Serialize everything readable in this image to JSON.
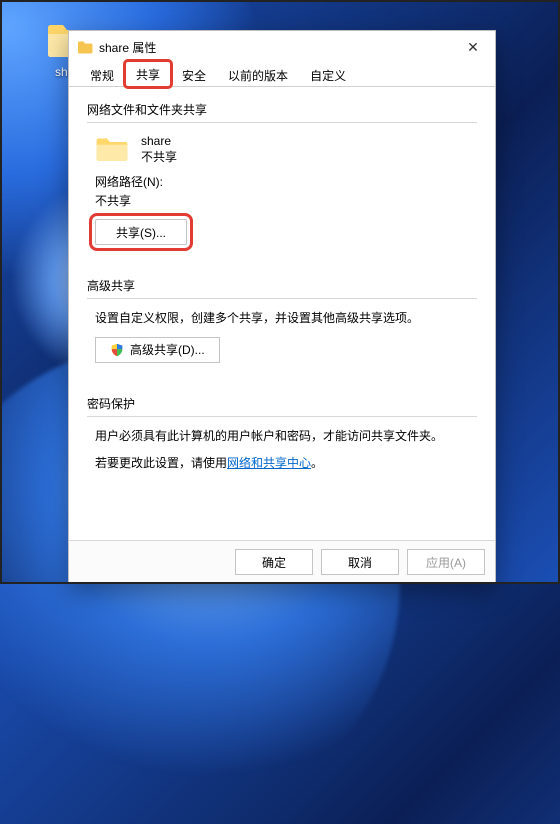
{
  "desktop": {
    "folder_label": "share"
  },
  "dialog": {
    "title": "share 属性",
    "tabs": {
      "general": "常规",
      "sharing": "共享",
      "security": "安全",
      "previous": "以前的版本",
      "customize": "自定义"
    },
    "section_network": {
      "title": "网络文件和文件夹共享",
      "folder_name": "share",
      "share_state": "不共享",
      "netpath_label": "网络路径(N):",
      "netpath_value": "不共享",
      "share_button": "共享(S)..."
    },
    "section_advanced": {
      "title": "高级共享",
      "desc": "设置自定义权限，创建多个共享，并设置其他高级共享选项。",
      "button": "高级共享(D)..."
    },
    "section_password": {
      "title": "密码保护",
      "line1": "用户必须具有此计算机的用户帐户和密码，才能访问共享文件夹。",
      "line2_prefix": "若要更改此设置，请使用",
      "line2_link": "网络和共享中心",
      "line2_suffix": "。"
    },
    "buttons": {
      "ok": "确定",
      "cancel": "取消",
      "apply": "应用(A)"
    }
  }
}
